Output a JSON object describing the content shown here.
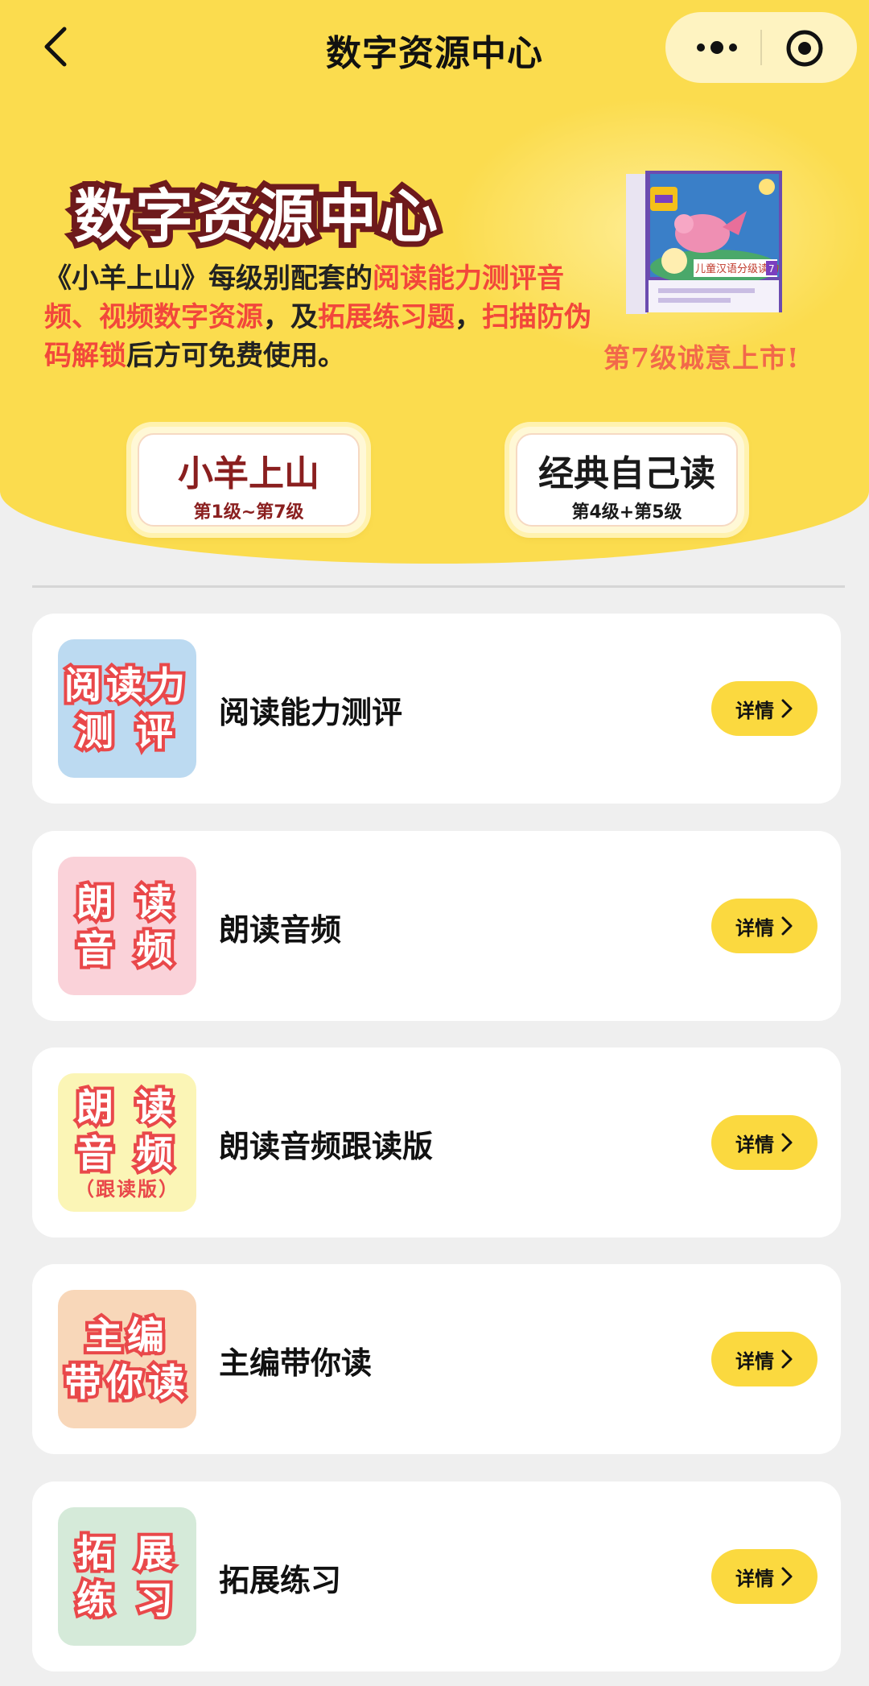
{
  "nav": {
    "title": "数字资源中心"
  },
  "banner": {
    "title": "数字资源中心",
    "desc_parts": [
      {
        "text": "《小羊上山》每级别配套的",
        "hl": false
      },
      {
        "text": "阅读能力测评音频、视频数字资源",
        "hl": true
      },
      {
        "text": "，及",
        "hl": false
      },
      {
        "text": "拓展练习题",
        "hl": true
      },
      {
        "text": "，",
        "hl": false
      },
      {
        "text": "扫描防伪码解锁",
        "hl": true
      },
      {
        "text": "后方可免费使用。",
        "hl": false
      }
    ],
    "launch_text": "第7级诚意上市!",
    "book_cover_title": "儿童汉语分级读物",
    "book_badge": "7"
  },
  "series": [
    {
      "name": "小羊上山",
      "range": "第1级~第7级",
      "name_color": "#8a1f1f"
    },
    {
      "name": "经典自己读",
      "range": "第4级+第5级",
      "name_color": "#1a1a1a"
    }
  ],
  "items": [
    {
      "label": "阅读能力测评",
      "icon_lines": [
        "阅读力",
        "测 评"
      ],
      "icon_sub": "",
      "icon_bg": "#bcdaf1",
      "button": "详情"
    },
    {
      "label": "朗读音频",
      "icon_lines": [
        "朗 读",
        "音 频"
      ],
      "icon_sub": "",
      "icon_bg": "#fad2d9",
      "button": "详情"
    },
    {
      "label": "朗读音频跟读版",
      "icon_lines": [
        "朗 读",
        "音 频"
      ],
      "icon_sub": "（跟读版）",
      "icon_bg": "#fbf5b6",
      "button": "详情"
    },
    {
      "label": "主编带你读",
      "icon_lines": [
        "主编",
        "带你读"
      ],
      "icon_sub": "",
      "icon_bg": "#f8d7b9",
      "button": "详情"
    },
    {
      "label": "拓展练习",
      "icon_lines": [
        "拓 展",
        "练 习"
      ],
      "icon_sub": "",
      "icon_bg": "#d5ead9",
      "button": "详情"
    }
  ]
}
